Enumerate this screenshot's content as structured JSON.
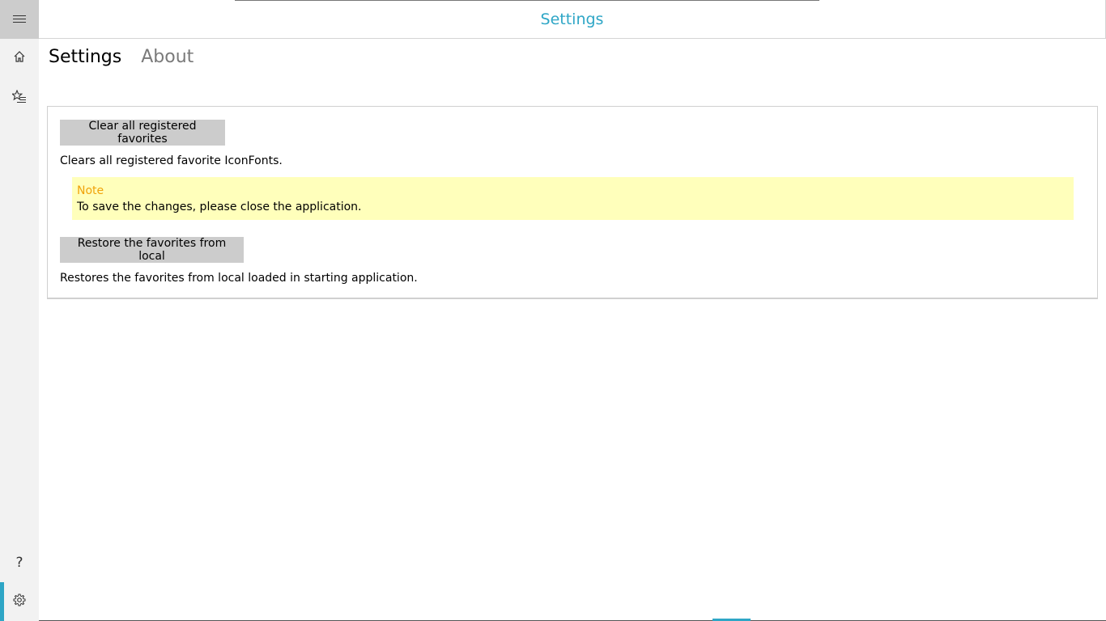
{
  "header": {
    "title": "Settings"
  },
  "nav": {
    "items": [
      {
        "icon": "hamburger-menu-icon",
        "label": ""
      },
      {
        "icon": "home-icon",
        "label": ""
      },
      {
        "icon": "favorites-list-icon",
        "label": ""
      },
      {
        "icon": "help-icon",
        "label": "?"
      },
      {
        "icon": "gear-icon",
        "label": ""
      }
    ],
    "selected": "settings"
  },
  "tabs": [
    {
      "label": "Settings",
      "active": true
    },
    {
      "label": "About",
      "active": false
    }
  ],
  "settings": {
    "clear_button": "Clear all registered favorites",
    "clear_desc": "Clears all registered favorite IconFonts.",
    "note_title": "Note",
    "note_text": "To save the changes, please close the application.",
    "restore_button": "Restore the favorites from local",
    "restore_desc": "Restores the favorites from local loaded in starting application."
  },
  "colors": {
    "accent": "#2ea6c6",
    "note_title": "#f0a30a",
    "note_bg": "#ffffbb",
    "button_bg": "#cccccc"
  }
}
